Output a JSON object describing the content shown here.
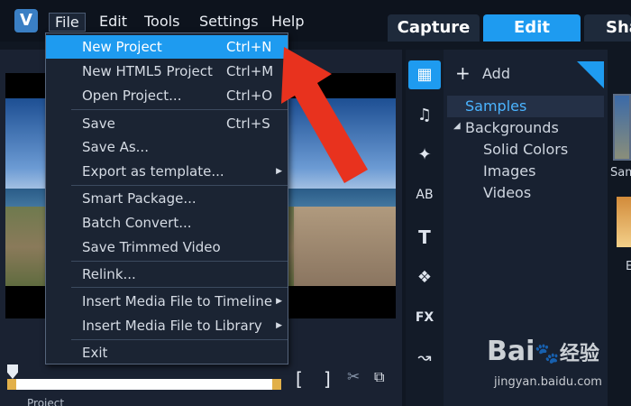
{
  "menubar": {
    "app_logo": "V",
    "items": [
      "File",
      "Edit",
      "Tools",
      "Settings",
      "Help"
    ]
  },
  "tabs": [
    "Capture",
    "Edit",
    "Sha"
  ],
  "file_menu": [
    {
      "label": "New Project",
      "shortcut": "Ctrl+N",
      "highlighted": true
    },
    {
      "label": "New HTML5 Project",
      "shortcut": "Ctrl+M"
    },
    {
      "label": "Open Project...",
      "shortcut": "Ctrl+O"
    },
    {
      "label": "Save",
      "shortcut": "Ctrl+S"
    },
    {
      "label": "Save As..."
    },
    {
      "label": "Export as template...",
      "submenu": true
    },
    {
      "label": "Smart Package..."
    },
    {
      "label": "Batch Convert..."
    },
    {
      "label": "Save Trimmed Video"
    },
    {
      "label": "Relink..."
    },
    {
      "label": "Insert Media File to Timeline",
      "submenu": true
    },
    {
      "label": "Insert Media File to Library",
      "submenu": true
    },
    {
      "label": "Exit"
    }
  ],
  "library": {
    "add_label": "Add",
    "items": [
      {
        "label": "Samples",
        "selected": true
      },
      {
        "label": "Backgrounds",
        "expanded": true
      },
      {
        "label": "Solid Colors"
      },
      {
        "label": "Images"
      },
      {
        "label": "Videos"
      }
    ]
  },
  "thumbs": {
    "first_label": "Sam",
    "second_label": "E"
  },
  "player": {
    "mark_in": "[",
    "mark_out": "]",
    "project_label": "Project"
  },
  "watermark": {
    "brand": "Bai",
    "brand2": "经验",
    "url": "jingyan.baidu.com"
  },
  "accent_color": "#1e9bf0",
  "arrow_color": "#e8321e"
}
